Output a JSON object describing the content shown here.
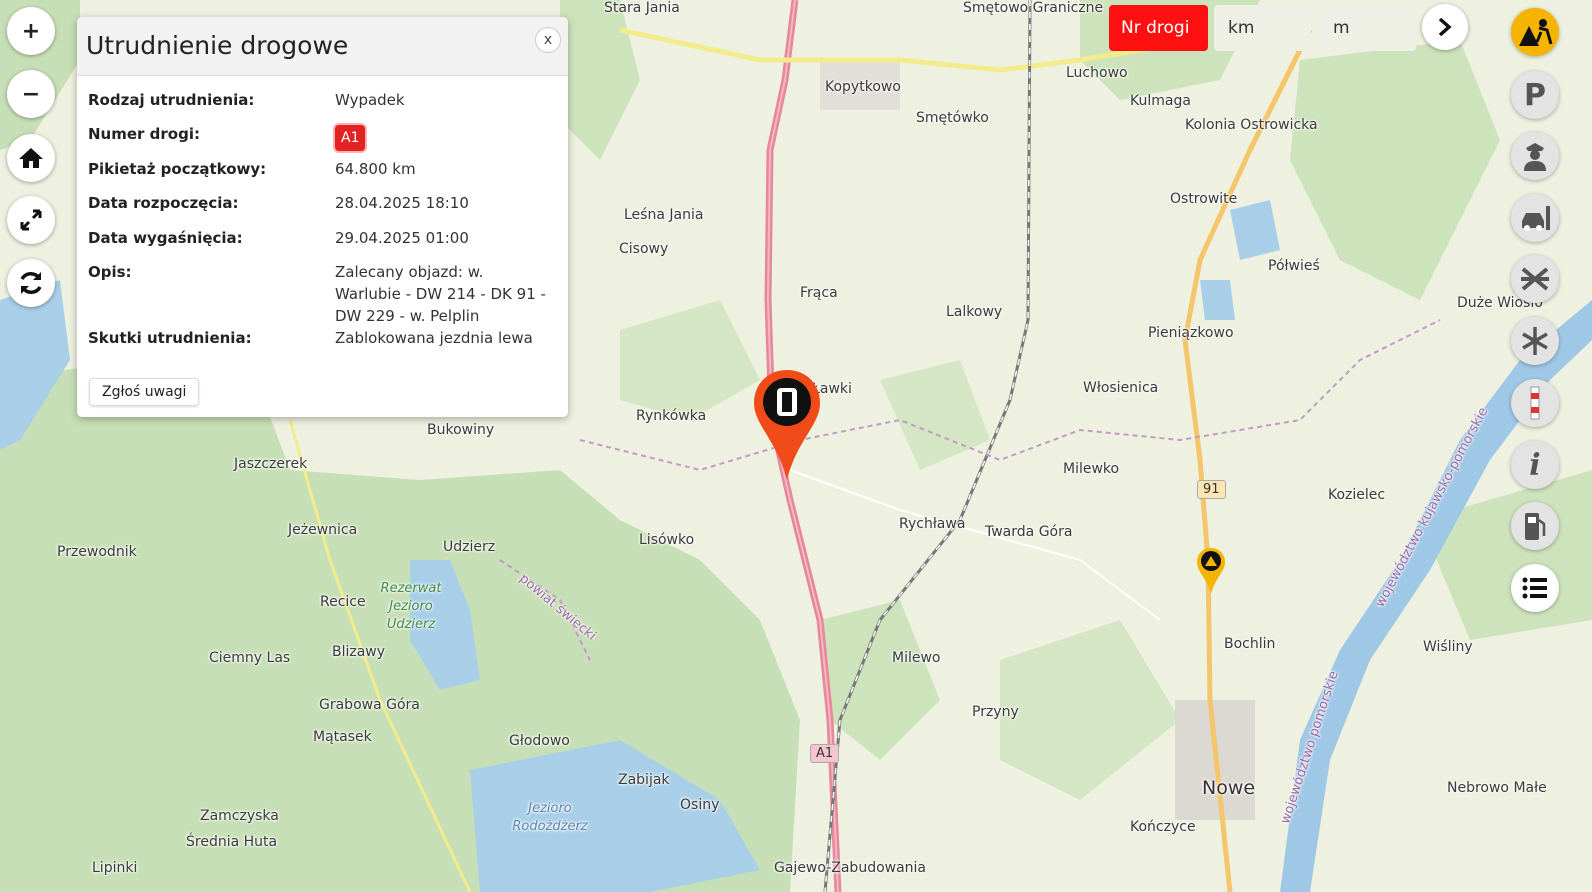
{
  "search": {
    "road_button": "Nr drogi",
    "km_placeholder": "km",
    "m_placeholder": "m"
  },
  "popup": {
    "title": "Utrudnienie drogowe",
    "close": "x",
    "rows": [
      {
        "label": "Rodzaj utrudnienia:",
        "value": "Wypadek"
      },
      {
        "label": "Numer drogi:",
        "value": "A1"
      },
      {
        "label": "Pikietaż początkowy:",
        "value": "64.800 km"
      },
      {
        "label": "Data rozpoczęcia:",
        "value": "28.04.2025 18:10"
      },
      {
        "label": "Data wygaśnięcia:",
        "value": "29.04.2025 01:00"
      },
      {
        "label": "Opis:",
        "value": "Zalecany objazd: w. Warlubie - DW 214 - DK 91 - DW 229 - w. Pelplin"
      },
      {
        "label": "Skutki utrudnienia:",
        "value": "Zablokowana jezdnia lewa"
      }
    ],
    "report_button": "Zgłoś uwagi"
  },
  "left_controls": {
    "zoom_in": "+",
    "zoom_out": "−"
  },
  "map": {
    "places": {
      "stara_jania": "Stara Jania",
      "smetowo_graniczne": "Smętowo Graniczne",
      "luchowo": "Luchowo",
      "kopytkowo": "Kopytkowo",
      "smetowko": "Smętówko",
      "kulmaga": "Kulmaga",
      "kolonia_ostrowicka": "Kolonia Ostrowicka",
      "ostrowite": "Ostrowite",
      "lesna_jania": "Leśna Jania",
      "cisowy": "Cisowy",
      "polwies": "Półwieś",
      "fraca": "Frąca",
      "lalkowy": "Lalkowy",
      "duze_wiosle": "Duże Wiosło",
      "pieniazkowo": "Pieniązkowo",
      "wlosienica": "Włosienica",
      "lawki": "Ławki",
      "rynkowka": "Rynkówka",
      "bukowiny": "Bukowiny",
      "jaszczerek": "Jaszczerek",
      "milewko": "Milewko",
      "kozielec": "Kozielec",
      "rychlawa": "Rychława",
      "twarda_gora": "Twarda Góra",
      "jezewnica": "Jeżewnica",
      "lisowko": "Lisówko",
      "udzierz": "Udzierz",
      "przewodnik": "Przewodnik",
      "bochlin": "Bochlin",
      "recice": "Recice",
      "ciemny_las": "Ciemny Las",
      "blizawy": "Blizawy",
      "milewo": "Milewo",
      "wisliny": "Wiśliny",
      "grabowa_gora": "Grabowa Góra",
      "przyny": "Przyny",
      "matasek": "Mątasek",
      "glodowo": "Głodowo",
      "zabijak": "Zabijak",
      "nowe": "Nowe",
      "nebrowo_male": "Nebrowo Małe",
      "osiny": "Osiny",
      "zamczyska": "Zamczyska",
      "srednia_huta": "Średnia Huta",
      "konczyce": "Kończyce",
      "lipinki": "Lipinki",
      "gajewo": "Gajewo-Zabudowania"
    },
    "water_labels": {
      "rezerwat": "Rezerwat Jezioro Udzierz",
      "jezioro_rododzierz": "Jezioro Rodożdżerz"
    },
    "border_labels": {
      "powiat": "powiat świecki",
      "wojewodztwo_kp": "województwo kujawsko-pomorskie",
      "wojewodztwo_pom": "województwo pomorskie"
    },
    "road_shields": {
      "a1": "A1",
      "r91": "91"
    }
  },
  "colors": {
    "motorway": "#e8869a",
    "accent_red": "#ff1010",
    "marker_red": "#f24b1a",
    "marker_yellow": "#f4b400",
    "forest": "#c5dfb4",
    "water": "#a9cfe8",
    "farmland": "#eef0e0"
  },
  "icons": {
    "right_controls": [
      "roadworks-icon",
      "parking-icon",
      "police-icon",
      "car-crash-icon",
      "closed-road-icon",
      "snowflake-icon",
      "barrier-icon",
      "info-icon",
      "fuel-station-icon",
      "list-icon"
    ]
  }
}
